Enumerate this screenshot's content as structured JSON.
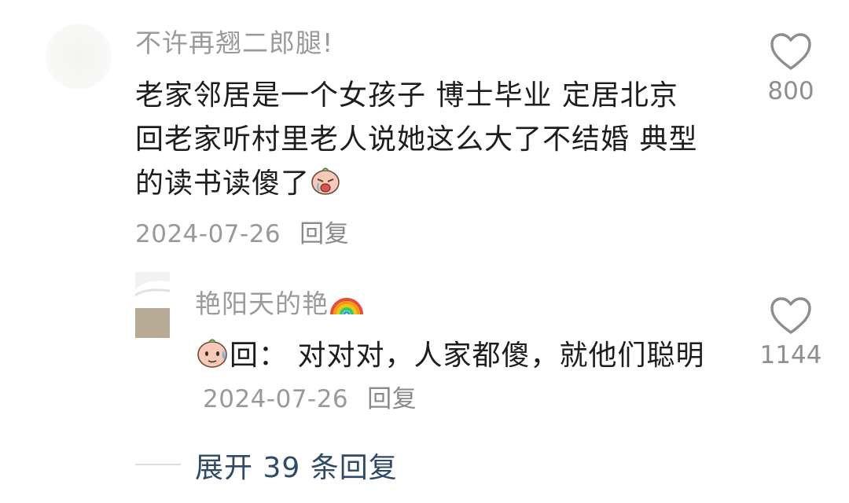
{
  "comment": {
    "username": "不许再翘二郎腿!",
    "text": "老家邻居是一个女孩子 博士毕业 定居北京 回老家听村里老人说她这么大了不结婚 典型的读书读傻了",
    "emoji": "crying-face-emoji",
    "date": "2024-07-26",
    "reply_label": "回复",
    "likes": "800"
  },
  "reply": {
    "username": "艳阳天的艳",
    "username_emoji": "rainbow-emoji",
    "prefix_emoji": "sweating-face-emoji",
    "text": "回： 对对对，人家都傻，就他们聪明",
    "date": "2024-07-26",
    "reply_label": "回复",
    "likes": "1144"
  },
  "expand": {
    "label": "展开 39 条回复"
  },
  "colors": {
    "username": "#9a9a9a",
    "body": "#1d1d1d",
    "meta": "#999999",
    "expand": "#2e4a66"
  }
}
